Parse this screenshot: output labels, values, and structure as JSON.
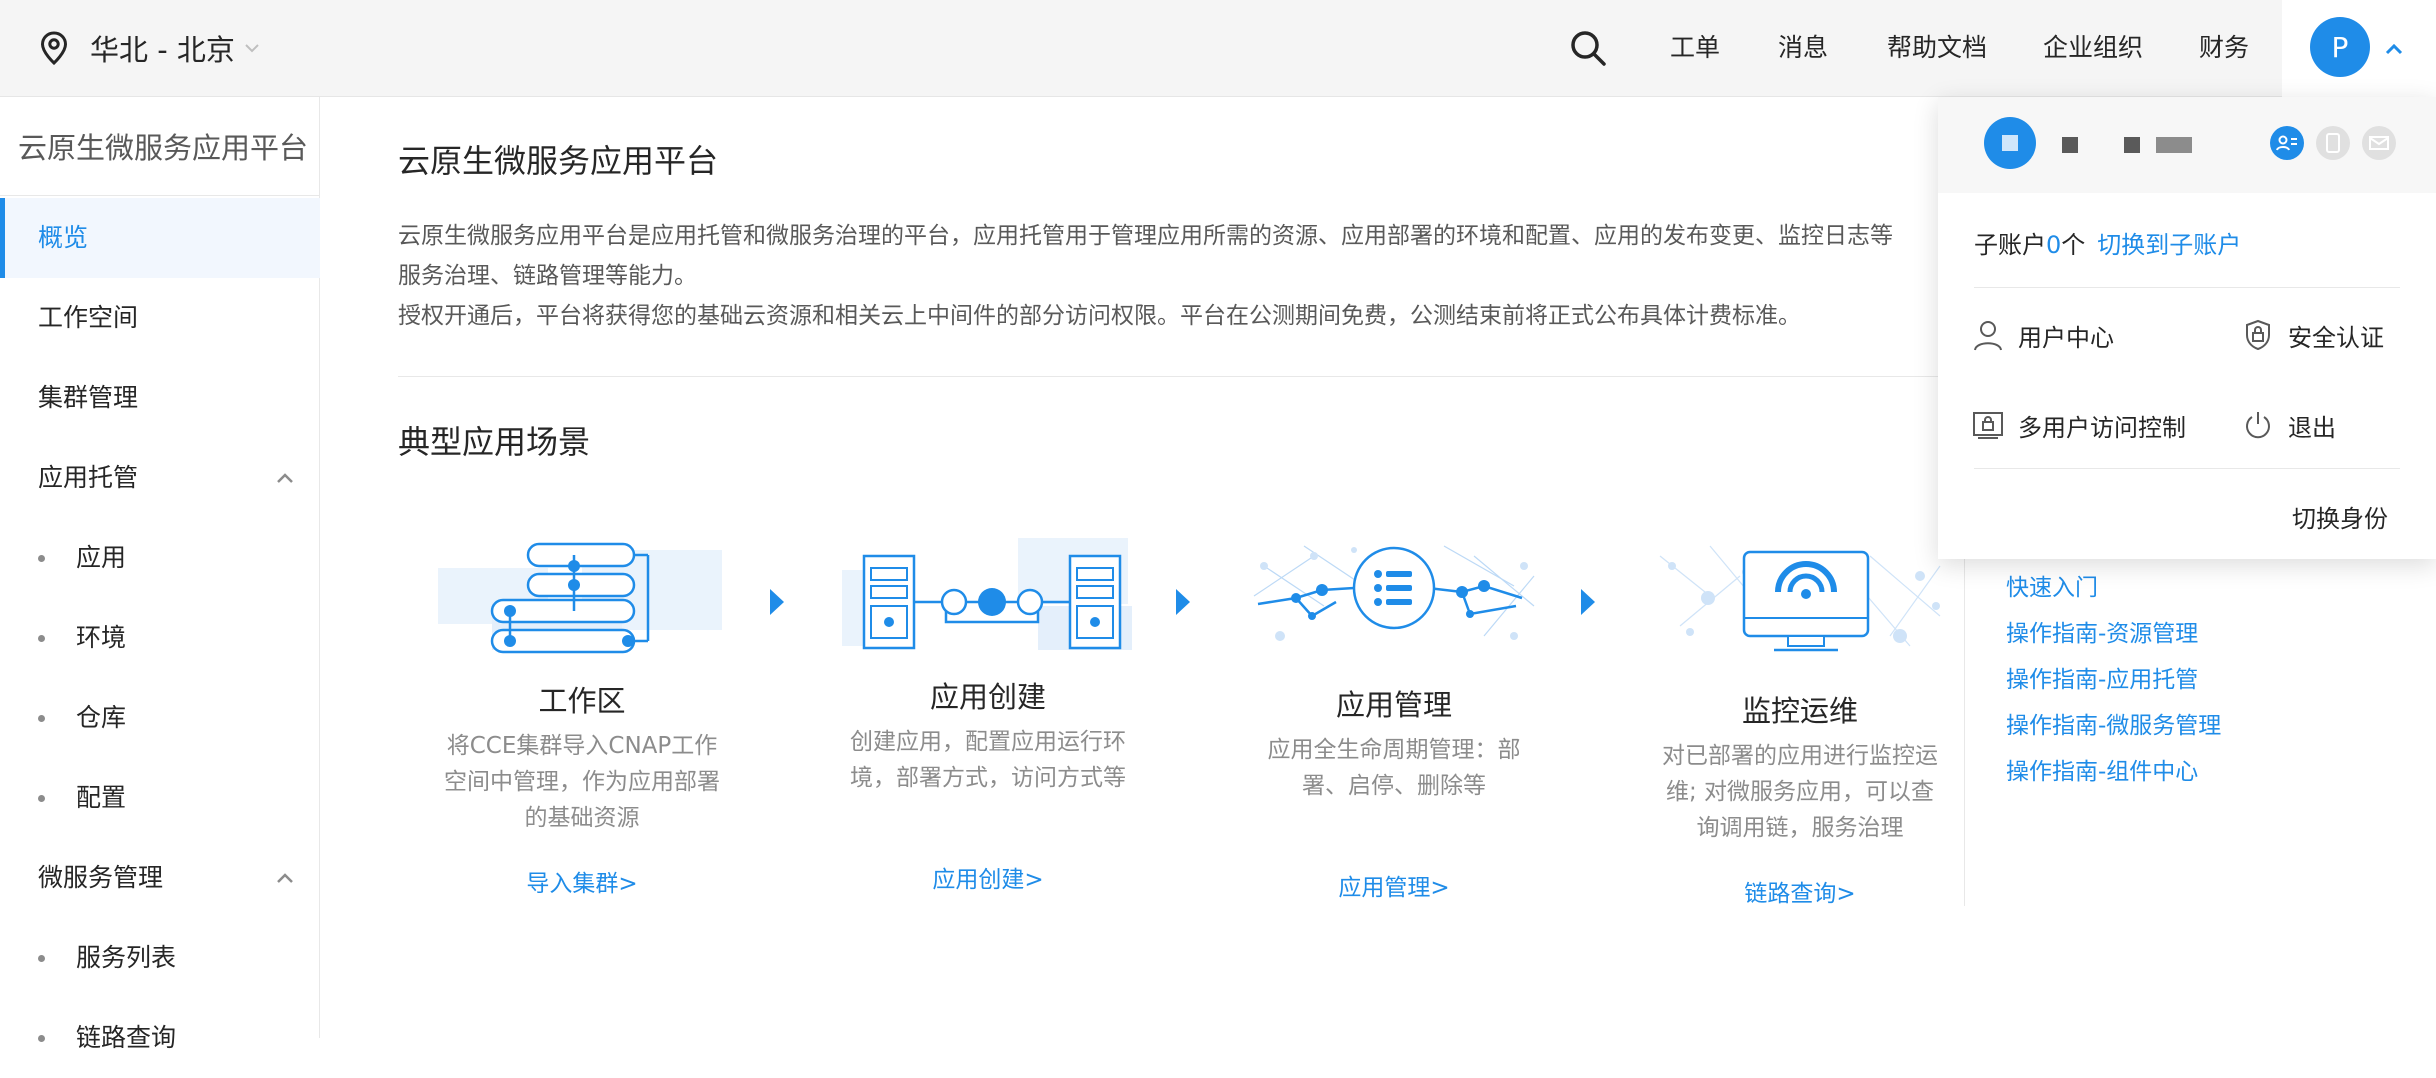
{
  "header": {
    "region": "华北 - 北京",
    "nav": [
      "工单",
      "消息",
      "帮助文档",
      "企业组织",
      "财务"
    ],
    "avatar_letter": "P",
    "icons": {
      "location": "location-pin-icon",
      "search": "search-icon",
      "caret": "chevron-up-icon"
    }
  },
  "sidebar": {
    "title": "云原生微服务应用平台",
    "items": [
      {
        "label": "概览",
        "active": true
      },
      {
        "label": "工作空间"
      },
      {
        "label": "集群管理"
      }
    ],
    "groups": [
      {
        "label": "应用托管",
        "children": [
          "应用",
          "环境",
          "仓库",
          "配置"
        ]
      },
      {
        "label": "微服务管理",
        "children": [
          "服务列表",
          "链路查询"
        ]
      }
    ]
  },
  "main": {
    "title": "云原生微服务应用平台",
    "description": [
      "云原生微服务应用平台是应用托管和微服务治理的平台，应用托管用于管理应用所需的资源、应用部署的环境和配置、应用的发布变更、监控日志等",
      "服务治理、链路管理等能力。",
      "授权开通后，平台将获得您的基础云资源和相关云上中间件的部分访问权限。平台在公测期间免费，公测结束前将正式公布具体计费标准。"
    ],
    "scenario_title": "典型应用场景",
    "scenarios": [
      {
        "title": "工作区",
        "desc": [
          "将CCE集群导入CNAP工作",
          "空间中管理，作为应用部署",
          "的基础资源"
        ],
        "link": "导入集群>"
      },
      {
        "title": "应用创建",
        "desc": [
          "创建应用，配置应用运行环",
          "境，部署方式，访问方式等"
        ],
        "link": "应用创建>"
      },
      {
        "title": "应用管理",
        "desc": [
          "应用全生命周期管理：部",
          "署、启停、删除等"
        ],
        "link": "应用管理>"
      },
      {
        "title": "监控运维",
        "desc": [
          "对已部署的应用进行监控运",
          "维; 对微服务应用，可以查",
          "询调用链，服务治理"
        ],
        "link": "链路查询>"
      }
    ],
    "quick_links": [
      "快速入门",
      "操作指南-资源管理",
      "操作指南-应用托管",
      "操作指南-微服务管理",
      "操作指南-组件中心"
    ]
  },
  "account_popup": {
    "sub_account_label": "子账户",
    "sub_account_count": "0",
    "sub_account_unit": "个",
    "switch_sub_link": "切换到子账户",
    "menu": [
      {
        "label": "用户中心",
        "icon": "user-icon"
      },
      {
        "label": "安全认证",
        "icon": "shield-lock-icon"
      },
      {
        "label": "多用户访问控制",
        "icon": "access-control-icon"
      },
      {
        "label": "退出",
        "icon": "power-icon"
      }
    ],
    "switch_identity": "切换身份",
    "header_icons": [
      "id-card-icon",
      "phone-icon",
      "mail-icon"
    ]
  },
  "colors": {
    "accent": "#1f8ce8",
    "topbar_bg": "#f5f5f5",
    "text": "#262626",
    "muted": "#8c8c8c"
  }
}
